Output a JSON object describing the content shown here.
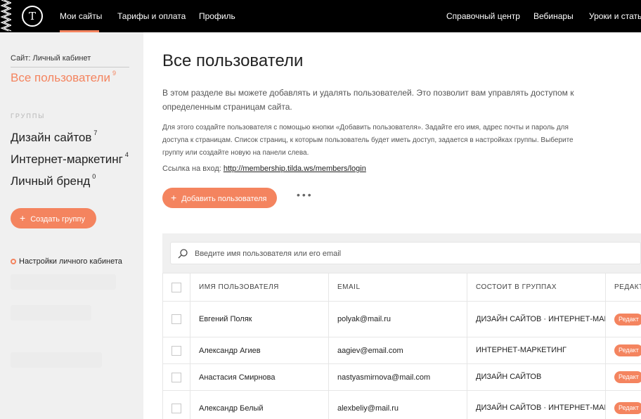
{
  "brand": {
    "logo_letter": "T",
    "accent": "#f4845f"
  },
  "topnav": {
    "left": [
      "Мои сайты",
      "Тарифы и оплата",
      "Профиль"
    ],
    "right": [
      "Справочный центр",
      "Вебинары",
      "Уроки и статьи"
    ],
    "active": "Мои сайты"
  },
  "sidebar": {
    "site_label": "Сайт: Личный кабинет",
    "all_users": {
      "label": "Все пользователи",
      "count": "9"
    },
    "groups_title": "ГРУППЫ",
    "groups": [
      {
        "name": "Дизайн сайтов",
        "count": "7"
      },
      {
        "name": "Интернет-маркетинг",
        "count": "4"
      },
      {
        "name": "Личный бренд",
        "count": "0"
      }
    ],
    "create_group": "Создать группу",
    "settings": "Настройки личного кабинета"
  },
  "main": {
    "title": "Все пользователи",
    "intro": "В этом разделе вы можете добавлять и удалять пользователей. Это позволит вам управлять доступом к определенным страницам сайта.",
    "hint": "Для этого создайте пользователя с помощью кнопки «Добавить пользователя». Задайте его имя, адрес почты и пароль для доступа к страницам. Список страниц, к которым пользователь будет иметь доступ, задается в настройках группы. Выберите группу или создайте новую на панели слева.",
    "login_label": "Ссылка на вход: ",
    "login_url": "http://membership.tilda.ws/members/login",
    "add_user": "Добавить пользователя",
    "more": "•••",
    "search_placeholder": "Введите имя пользователя или его email"
  },
  "table": {
    "headers": [
      "ИМЯ ПОЛЬЗОВАТЕЛЯ",
      "EMAIL",
      "СОСТОИТ В ГРУППАХ",
      "РЕДАКТИ"
    ],
    "edit_label": "Редакт",
    "rows": [
      {
        "name": "Евгений Поляк",
        "email": "polyak@mail.ru",
        "groups": "ДИЗАЙН САЙТОВ · ИНТЕРНЕТ-МАРКЕТИНГ"
      },
      {
        "name": "Александр Агиев",
        "email": "aagiev@email.com",
        "groups": "ИНТЕРНЕТ-МАРКЕТИНГ"
      },
      {
        "name": "Анастасия Смирнова",
        "email": "nastyasmirnova@mail.com",
        "groups": "ДИЗАЙН САЙТОВ"
      },
      {
        "name": "Александр Белый",
        "email": "alexbeliy@mail.ru",
        "groups": "ДИЗАЙН САЙТОВ · ИНТЕРНЕТ-МАРКЕТИНГ"
      }
    ]
  }
}
